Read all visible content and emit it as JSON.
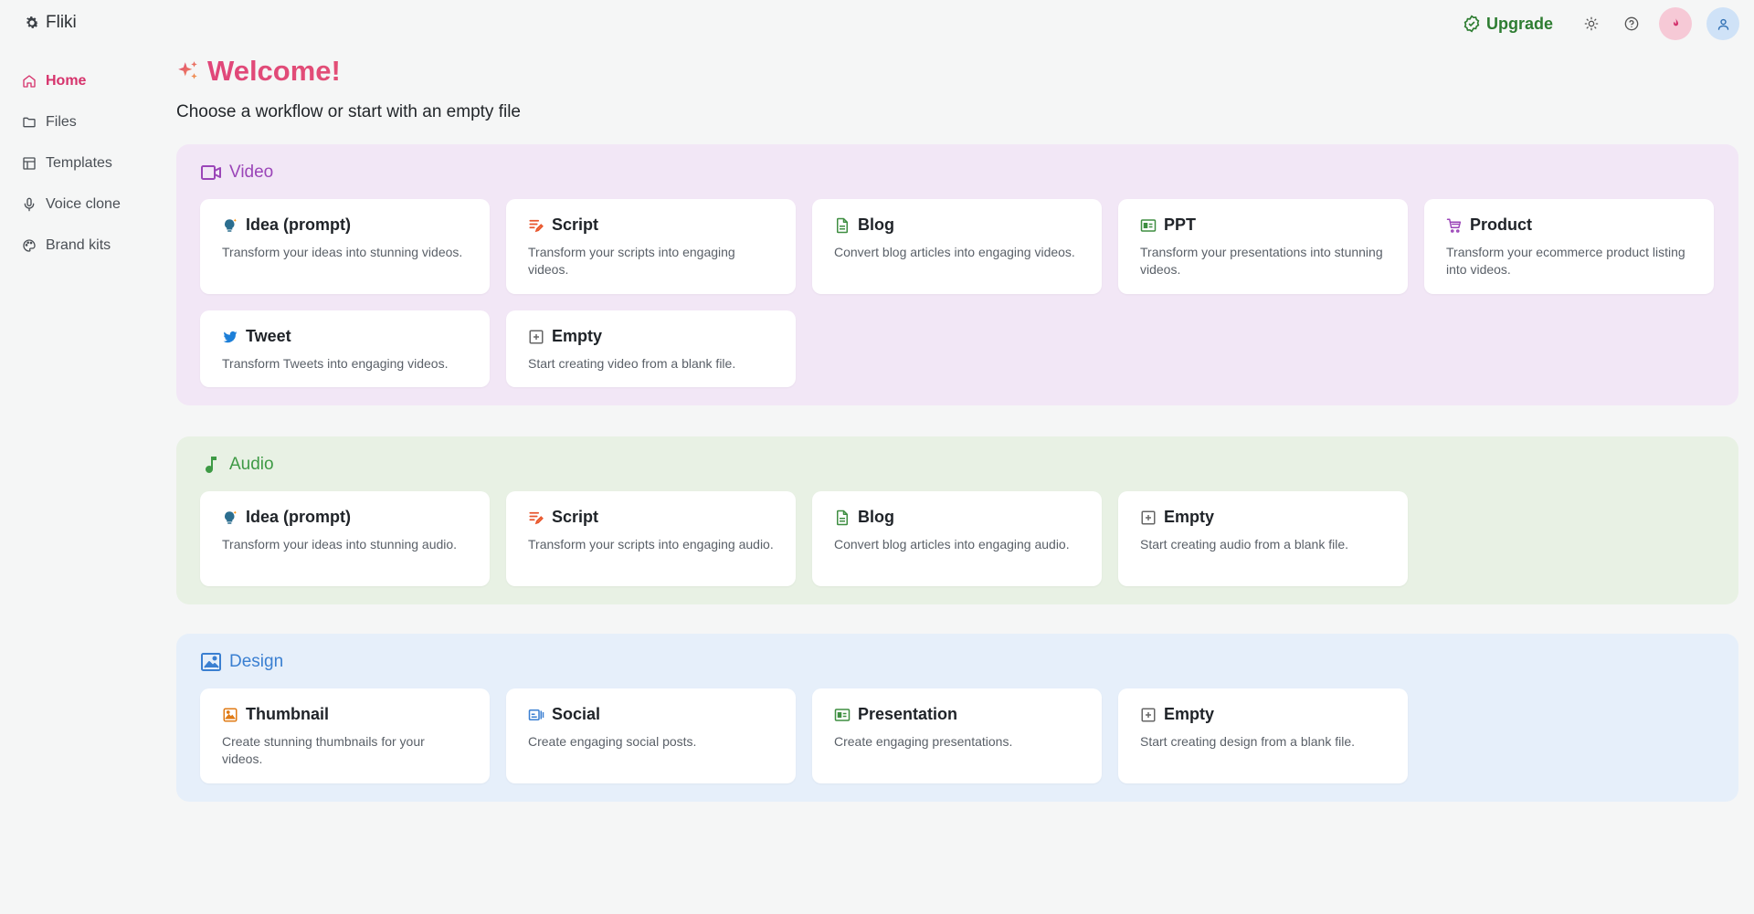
{
  "app": {
    "name": "Fliki"
  },
  "topbar": {
    "upgrade_label": "Upgrade"
  },
  "sidebar": {
    "items": [
      {
        "label": "Home",
        "icon": "home-icon",
        "active": true
      },
      {
        "label": "Files",
        "icon": "folder-icon"
      },
      {
        "label": "Templates",
        "icon": "templates-icon"
      },
      {
        "label": "Voice clone",
        "icon": "microphone-icon"
      },
      {
        "label": "Brand kits",
        "icon": "palette-icon"
      }
    ]
  },
  "main": {
    "welcome": "Welcome!",
    "subtitle": "Choose a workflow or start with an empty file"
  },
  "sections": {
    "video": {
      "title": "Video",
      "cards": [
        {
          "title": "Idea (prompt)",
          "desc": "Transform your ideas into stunning videos."
        },
        {
          "title": "Script",
          "desc": "Transform your scripts into engaging videos."
        },
        {
          "title": "Blog",
          "desc": "Convert blog articles into engaging videos."
        },
        {
          "title": "PPT",
          "desc": "Transform your presentations into stunning videos."
        },
        {
          "title": "Product",
          "desc": "Transform your ecommerce product listing into videos."
        },
        {
          "title": "Tweet",
          "desc": "Transform Tweets into engaging videos."
        },
        {
          "title": "Empty",
          "desc": "Start creating video from a blank file."
        }
      ]
    },
    "audio": {
      "title": "Audio",
      "cards": [
        {
          "title": "Idea (prompt)",
          "desc": "Transform your ideas into stunning audio."
        },
        {
          "title": "Script",
          "desc": "Transform your scripts into engaging audio."
        },
        {
          "title": "Blog",
          "desc": "Convert blog articles into engaging audio."
        },
        {
          "title": "Empty",
          "desc": "Start creating audio from a blank file."
        }
      ]
    },
    "design": {
      "title": "Design",
      "cards": [
        {
          "title": "Thumbnail",
          "desc": "Create stunning thumbnails for your videos."
        },
        {
          "title": "Social",
          "desc": "Create engaging social posts."
        },
        {
          "title": "Presentation",
          "desc": "Create engaging presentations."
        },
        {
          "title": "Empty",
          "desc": "Start creating design from a blank file."
        }
      ]
    }
  },
  "colors": {
    "accent": "#d6336c",
    "upgrade": "#2e7d32",
    "video": "#9b45b8",
    "audio": "#3e9a45",
    "design": "#3a7fd1"
  }
}
